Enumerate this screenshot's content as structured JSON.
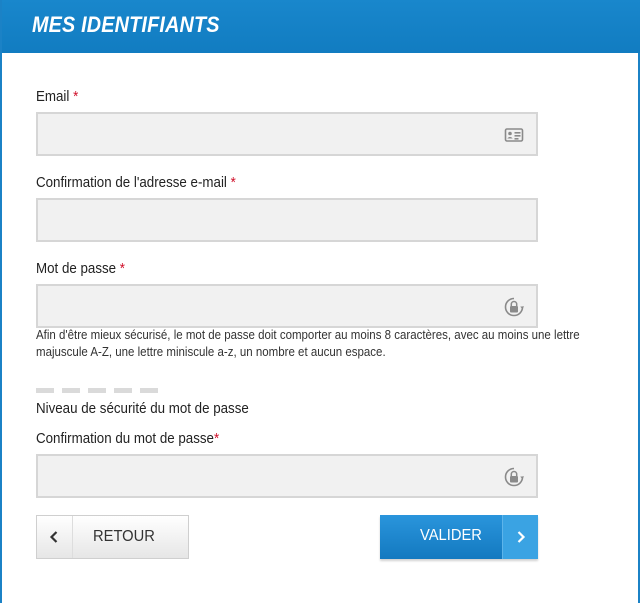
{
  "header": {
    "title": "MES IDENTIFIANTS"
  },
  "form": {
    "required_mark": "*",
    "email": {
      "label": "Email",
      "value": "",
      "icon": "id-card-icon"
    },
    "email_confirm": {
      "label": "Confirmation de l'adresse e-mail",
      "value": ""
    },
    "password": {
      "label": "Mot de passe",
      "value": "",
      "icon": "lock-icon",
      "hint_line1": "Afin d'être mieux sécurisé, le mot de passe doit comporter au moins 8 caractères, avec au moins une lettre",
      "hint_line2": "majuscule A-Z, une lettre miniscule a-z, un nombre et aucun espace."
    },
    "strength": {
      "label": "Niveau de sécurité du mot de passe",
      "segments": 5,
      "level": 0
    },
    "password_confirm": {
      "label": "Confirmation du mot de passe",
      "value": "",
      "icon": "lock-icon"
    }
  },
  "buttons": {
    "back": {
      "label": "RETOUR",
      "icon": "chevron-left-icon"
    },
    "submit": {
      "label": "VALIDER",
      "icon": "chevron-right-icon"
    }
  },
  "colors": {
    "header_blue": "#1b82c6",
    "required_red": "#d0102a",
    "submit_blue": "#1b86cf",
    "field_bg": "#f1f1f1",
    "strength_inactive": "#dadada"
  }
}
